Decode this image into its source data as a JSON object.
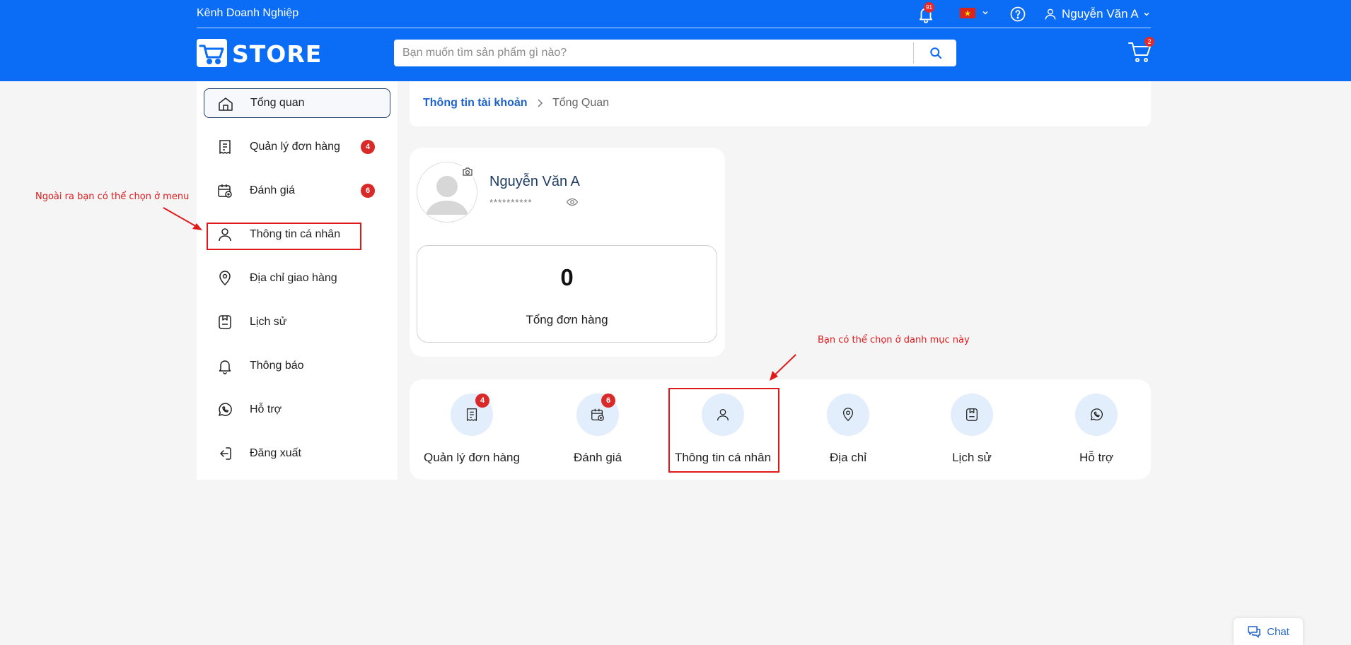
{
  "header": {
    "business_link": "Kênh Doanh Nghiệp",
    "notification_count": "91",
    "language_flag": "vietnam-flag",
    "user_name": "Nguyễn Văn A",
    "logo_text": "STORE",
    "search_placeholder": "Bạn muốn tìm sản phẩm gì nào?",
    "cart_count": "2",
    "brand_color": "#0b6cf5"
  },
  "sidebar": {
    "items": [
      {
        "label": "Tổng quan",
        "icon": "home-icon",
        "active": true
      },
      {
        "label": "Quản lý đơn hàng",
        "icon": "receipt-icon",
        "badge": "4"
      },
      {
        "label": "Đánh giá",
        "icon": "calendar-review-icon",
        "badge": "6"
      },
      {
        "label": "Thông tin cá nhân",
        "icon": "user-icon"
      },
      {
        "label": "Địa chỉ giao hàng",
        "icon": "location-pin-icon"
      },
      {
        "label": "Lịch sử",
        "icon": "history-icon"
      },
      {
        "label": "Thông báo",
        "icon": "bell-icon"
      },
      {
        "label": "Hỗ trợ",
        "icon": "whatsapp-icon"
      },
      {
        "label": "Đăng xuất",
        "icon": "logout-icon"
      }
    ]
  },
  "breadcrumb": {
    "parent": "Thông tin tài khoản",
    "current": "Tổng Quan"
  },
  "profile": {
    "name": "Nguyễn Văn A",
    "password_mask": "**********",
    "total_orders": "0",
    "total_orders_label": "Tổng đơn hàng"
  },
  "quick_links": [
    {
      "label": "Quản lý đơn hàng",
      "icon": "receipt-icon",
      "badge": "4"
    },
    {
      "label": "Đánh giá",
      "icon": "calendar-review-icon",
      "badge": "6"
    },
    {
      "label": "Thông tin cá nhân",
      "icon": "user-icon"
    },
    {
      "label": "Địa chỉ",
      "icon": "location-pin-icon"
    },
    {
      "label": "Lịch sử",
      "icon": "history-icon"
    },
    {
      "label": "Hỗ trợ",
      "icon": "whatsapp-icon"
    }
  ],
  "annotations": {
    "menu_note": "Ngoài ra bạn có thể chọn ở menu",
    "category_note": "Bạn có thể chọn ở danh mục này",
    "annotation_color": "#e0191b"
  },
  "chat": {
    "label": "Chat"
  }
}
